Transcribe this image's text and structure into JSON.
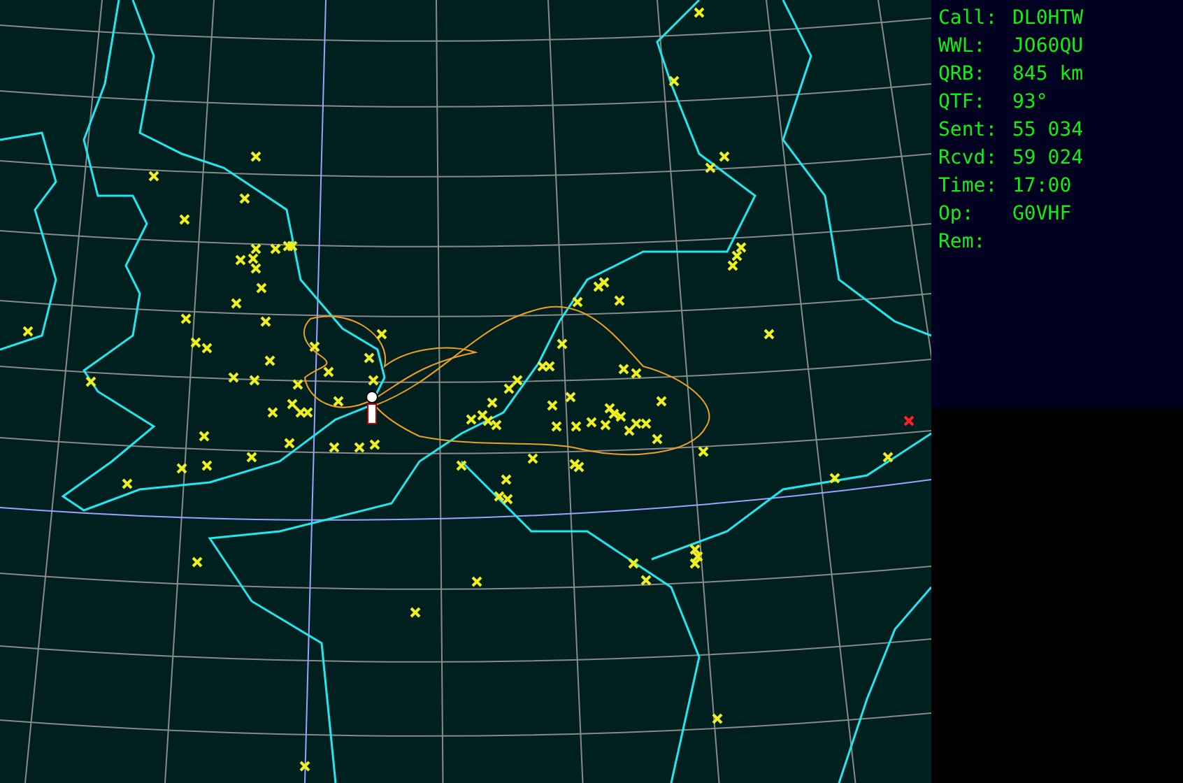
{
  "info_panel": {
    "fields": [
      {
        "label": "Call:",
        "value": "DL0HTW"
      },
      {
        "label": "WWL:",
        "value": "JO60QU"
      },
      {
        "label": "QRB:",
        "value": "845 km"
      },
      {
        "label": "QTF:",
        "value": "93°"
      },
      {
        "label": "Sent:",
        "value": "55 034"
      },
      {
        "label": "Rcvd:",
        "value": "59 024"
      },
      {
        "label": "Time:",
        "value": "17:00"
      },
      {
        "label": "Op:",
        "value": "G0VHF"
      },
      {
        "label": "Rem:"
      }
    ]
  }
}
